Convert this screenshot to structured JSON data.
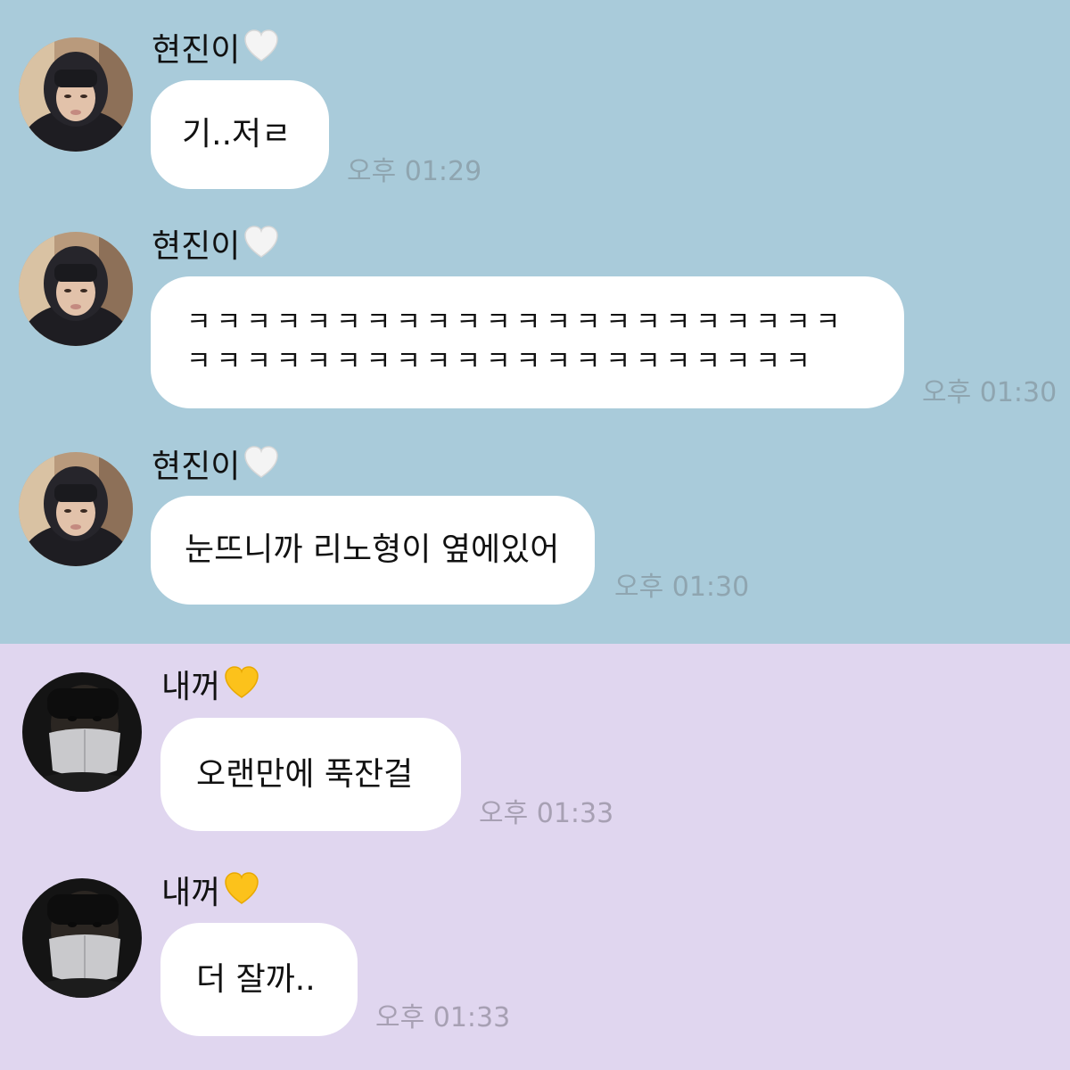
{
  "colors": {
    "top_background": "#a9cbda",
    "bottom_background": "#e0d6ef",
    "bubble": "#ffffff",
    "timestamp": "#8fa5b0"
  },
  "messages": [
    {
      "sender": "현진이",
      "sender_heart": "white-heart-icon",
      "text": "기..저ㄹ",
      "time": "오후 01:29"
    },
    {
      "sender": "현진이",
      "sender_heart": "white-heart-icon",
      "text": "ㅋㅋㅋㅋㅋㅋㅋㅋㅋㅋㅋㅋㅋㅋㅋㅋㅋㅋㅋㅋㅋㅋㅋㅋㅋㅋㅋㅋㅋㅋㅋㅋㅋㅋㅋㅋㅋㅋㅋㅋㅋㅋㅋ",
      "time": "오후 01:30"
    },
    {
      "sender": "현진이",
      "sender_heart": "white-heart-icon",
      "text": "눈뜨니까 리노형이 옆에있어",
      "time": "오후 01:30"
    },
    {
      "sender": "내꺼",
      "sender_heart": "yellow-heart-icon",
      "text": "오랜만에 푹잔걸",
      "time": "오후 01:33"
    },
    {
      "sender": "내꺼",
      "sender_heart": "yellow-heart-icon",
      "text": "더 잘까..",
      "time": "오후 01:33"
    }
  ]
}
